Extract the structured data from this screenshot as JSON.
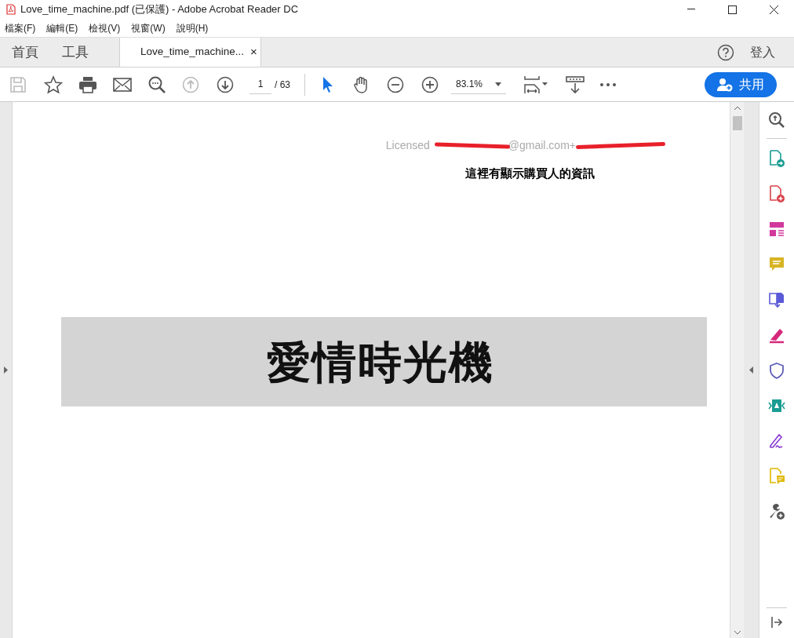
{
  "window": {
    "title": "Love_time_machine.pdf (已保護) - Adobe Acrobat Reader DC"
  },
  "menu": [
    "檔案(F)",
    "編輯(E)",
    "檢視(V)",
    "視窗(W)",
    "說明(H)"
  ],
  "nav_tabs": [
    {
      "label": "首頁",
      "selected": false
    },
    {
      "label": "工具",
      "selected": false
    }
  ],
  "document_tab": {
    "label": "Love_time_machine...",
    "close": "×",
    "selected": true
  },
  "account": {
    "sign_in": "登入"
  },
  "toolbar": {
    "page": "1",
    "page_total": "/ 63",
    "zoom": "83.1%",
    "share": "共用"
  },
  "page": {
    "license": [
      "Licensed",
      "@gmail.com+"
    ],
    "note": "這裡有顯示購買人的資訊",
    "title": "愛情時光機"
  },
  "tools": [
    {
      "kind": "zoom",
      "color": "#555555"
    },
    {
      "kind": "export",
      "color": "#1a9c93"
    },
    {
      "kind": "create",
      "color": "#d9434b"
    },
    {
      "kind": "organize",
      "color": "#d1399b"
    },
    {
      "kind": "comment",
      "color": "#d8b426"
    },
    {
      "kind": "combine",
      "color": "#5a5ad8"
    },
    {
      "kind": "fill",
      "color": "#d6287a"
    },
    {
      "kind": "protect",
      "color": "#5e5eb8"
    },
    {
      "kind": "compress",
      "color": "#1a9c93"
    },
    {
      "kind": "sign",
      "color": "#8a3fd0"
    },
    {
      "kind": "send",
      "color": "#e0b800"
    },
    {
      "kind": "more",
      "color": "#555555"
    }
  ]
}
